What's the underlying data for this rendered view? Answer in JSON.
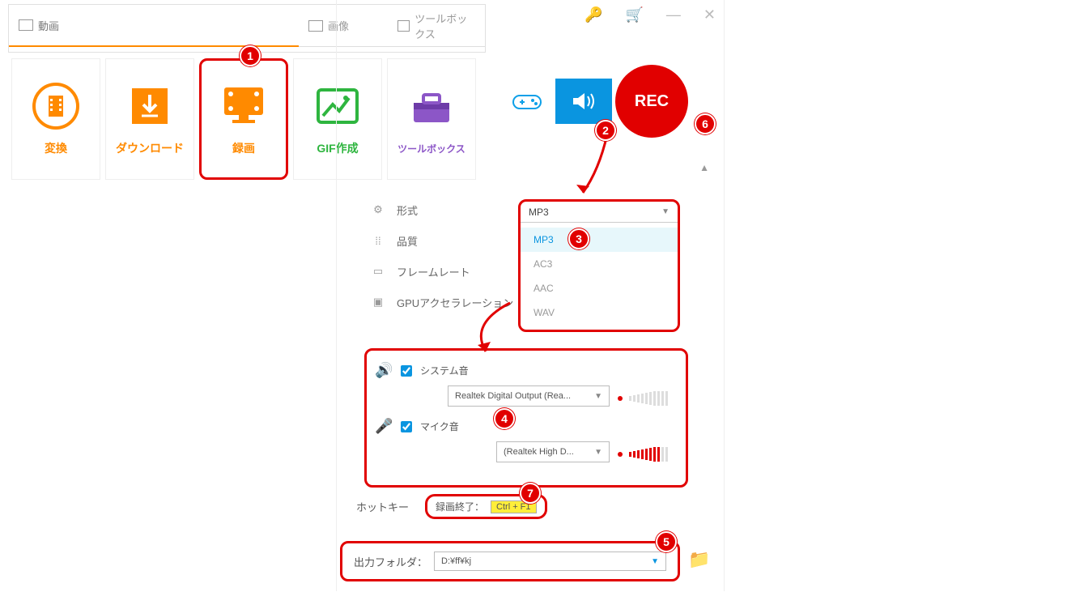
{
  "tabs": {
    "video": "動画",
    "image": "画像",
    "toolbox": "ツールボックス"
  },
  "tiles": {
    "convert": "変換",
    "download": "ダウンロード",
    "record": "録画",
    "gif": "GIF作成",
    "toolbox": "ツールボックス"
  },
  "rec_label": "REC",
  "settings": {
    "format": "形式",
    "quality": "品質",
    "framerate": "フレームレート",
    "gpu": "GPUアクセラレーション"
  },
  "format_selected": "MP3",
  "format_options": {
    "mp3": "MP3",
    "ac3": "AC3",
    "aac": "AAC",
    "wav": "WAV"
  },
  "audio": {
    "system_label": "システム音",
    "system_device": "Realtek Digital Output (Rea...",
    "mic_label": "マイク音",
    "mic_device": "(Realtek High D..."
  },
  "hotkey": {
    "label": "ホットキー",
    "end_label": "録画終了：",
    "combo": "Ctrl + F1"
  },
  "output": {
    "label": "出力フォルダ：",
    "path": "D:¥ff¥kj"
  },
  "badges": {
    "b1": "1",
    "b2": "2",
    "b3": "3",
    "b4": "4",
    "b5": "5",
    "b6": "6",
    "b7": "7"
  }
}
